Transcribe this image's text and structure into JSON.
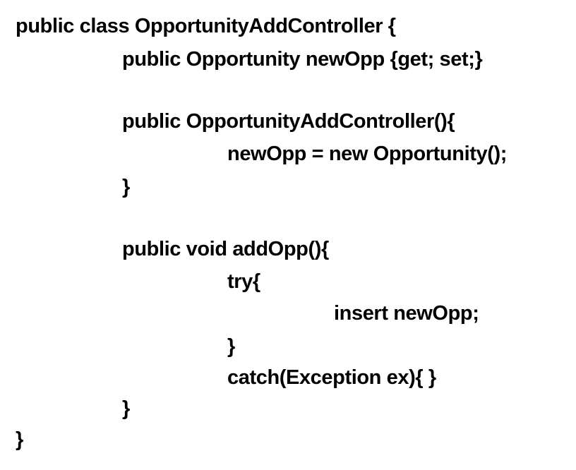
{
  "code": {
    "lines": [
      {
        "text": "public class OpportunityAddController {",
        "indent": 0
      },
      {
        "text": "public Opportunity newOpp {get; set;}",
        "indent": 1
      },
      {
        "text": "",
        "indent": 0
      },
      {
        "text": "public OpportunityAddController(){",
        "indent": 1
      },
      {
        "text": "newOpp = new Opportunity();",
        "indent": 2
      },
      {
        "text": "}",
        "indent": 1
      },
      {
        "text": "",
        "indent": 0
      },
      {
        "text": "public void addOpp(){",
        "indent": 1
      },
      {
        "text": "try{",
        "indent": 2
      },
      {
        "text": "insert newOpp;",
        "indent": 3
      },
      {
        "text": "}",
        "indent": 2
      },
      {
        "text": "catch(Exception ex){ }",
        "indent": 2
      },
      {
        "text": "}",
        "indent": 1
      },
      {
        "text": "}",
        "indent": 0
      }
    ]
  }
}
